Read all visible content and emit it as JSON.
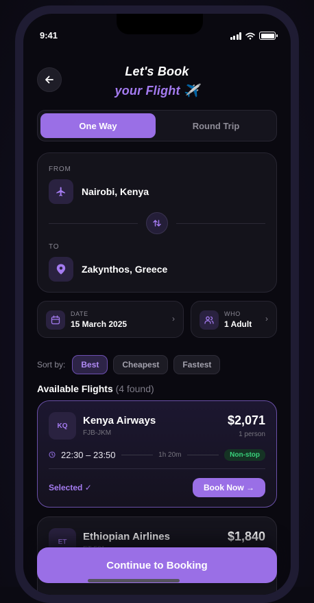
{
  "status": {
    "time": "9:41"
  },
  "header": {
    "title_line1": "Let's Book",
    "title_line2": "your Flight",
    "title_emoji": "✈️"
  },
  "trip_type": {
    "options": [
      "One Way",
      "Round Trip"
    ],
    "selected": "One Way"
  },
  "route": {
    "from_label": "FROM",
    "from_value": "Nairobi, Kenya",
    "to_label": "TO",
    "to_value": "Zakynthos, Greece"
  },
  "date": {
    "label": "DATE",
    "value": "15 March 2025"
  },
  "who": {
    "label": "WHO",
    "value": "1 Adult"
  },
  "sort": {
    "label": "Sort by:",
    "options": [
      "Best",
      "Cheapest",
      "Fastest"
    ],
    "selected": "Best"
  },
  "flights_section": {
    "title": "Available Flights",
    "count": "(4 found)"
  },
  "flights": [
    {
      "code": "KQ",
      "airline": "Kenya Airways",
      "flight_no": "FJB-JKM",
      "price": "$2,071",
      "per": "1 person",
      "times": "22:30 – 23:50",
      "duration": "1h 20m",
      "stops": "Non-stop",
      "selected_label": "Selected ✓",
      "action": "Book Now →"
    },
    {
      "code": "ET",
      "airline": "Ethiopian Airlines",
      "flight_no": "ET-501",
      "price": "$1,840"
    }
  ],
  "cta": {
    "label": "Continue to Booking"
  },
  "colors": {
    "accent": "#9a6fe6",
    "accent_text": "#a47bf0",
    "background": "#0a0910",
    "success": "#38d27a"
  }
}
